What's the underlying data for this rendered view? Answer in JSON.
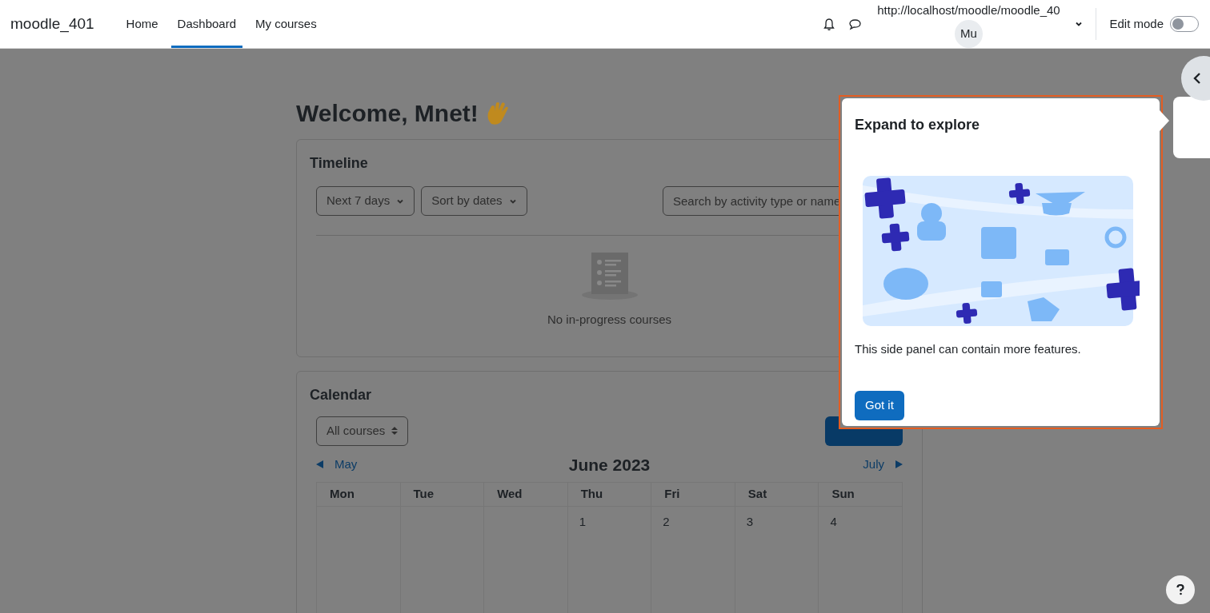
{
  "header": {
    "site_name": "moodle_401",
    "nav": [
      {
        "label": "Home",
        "selected": false
      },
      {
        "label": "Dashboard",
        "selected": true
      },
      {
        "label": "My courses",
        "selected": false
      }
    ],
    "user_url": "http://localhost/moodle/moodle_40",
    "avatar": "Mu",
    "edit_mode": {
      "label": "Edit mode",
      "on": false
    }
  },
  "welcome": "Welcome, Mnet!",
  "timeline": {
    "title": "Timeline",
    "filters": [
      "Next 7 days",
      "Sort by dates"
    ],
    "search": {
      "placeholder": "Search by activity type or name"
    },
    "empty_message": "No in-progress courses"
  },
  "calendar": {
    "title": "Calendar",
    "course_filter": "All courses",
    "prev": "May",
    "month": "June 2023",
    "next": "July",
    "days": [
      {
        "label": "Mon"
      },
      {
        "label": "Tue"
      },
      {
        "label": "Wed"
      },
      {
        "label": "Thu",
        "date": "1"
      },
      {
        "label": "Fri",
        "date": "2"
      },
      {
        "label": "Sat",
        "date": "3"
      },
      {
        "label": "Sun",
        "date": "4"
      }
    ]
  },
  "popover": {
    "title": "Expand to explore",
    "text": "This side panel can contain more features.",
    "button": "Got it"
  }
}
